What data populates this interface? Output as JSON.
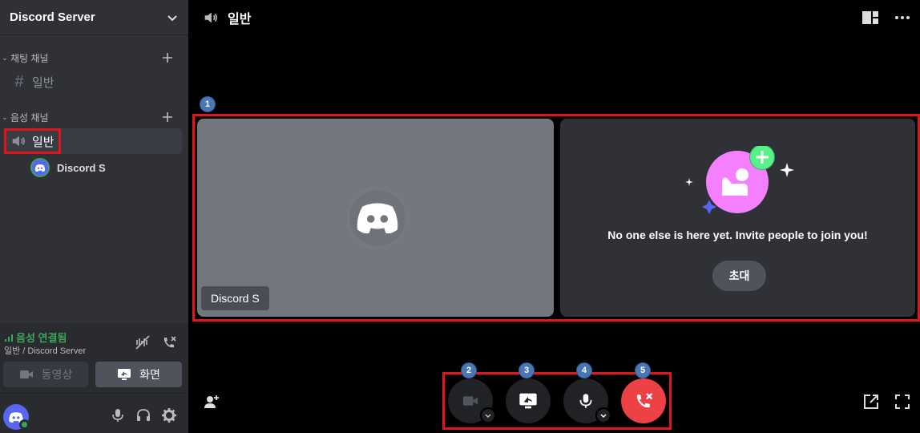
{
  "server": {
    "name": "Discord Server"
  },
  "categories": [
    {
      "label": "채팅 채널"
    },
    {
      "label": "음성 채널"
    }
  ],
  "text_channel": {
    "name": "일반"
  },
  "voice_channel": {
    "name": "일반"
  },
  "voice_user": {
    "name": "Discord S"
  },
  "voice_status": {
    "title": "음성 연결됨",
    "subtitle": "일반 / Discord Server",
    "video_label": "동영상",
    "screen_label": "화면"
  },
  "main": {
    "title": "일반",
    "tile_name": "Discord S",
    "invite_text": "No one else is here yet. Invite people to join you!",
    "invite_button": "초대"
  },
  "annotations": [
    "1",
    "2",
    "3",
    "4",
    "5"
  ],
  "colors": {
    "accent": "#5865f2",
    "connected": "#3ba55c",
    "end_call": "#ed4245",
    "highlight_box": "#e0161e",
    "badge": "#4a77b4"
  }
}
